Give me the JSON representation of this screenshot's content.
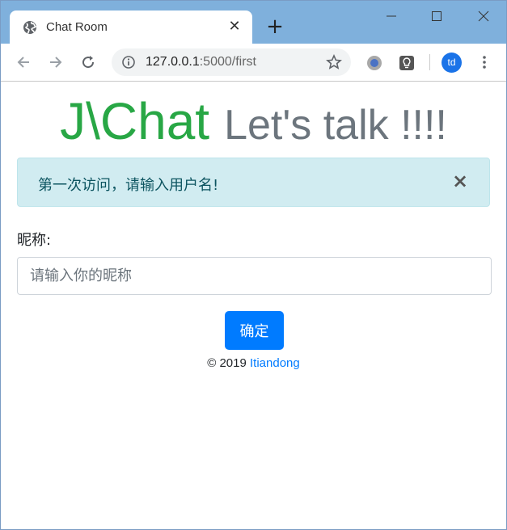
{
  "browser": {
    "tab_title": "Chat Room",
    "new_tab_label": "+",
    "url_host": "127.0.0.1",
    "url_path": ":5000/first",
    "avatar_initials": "td",
    "colors": {
      "titlebar": "#7fb0dc",
      "avatar": "#1a73e8"
    }
  },
  "page": {
    "brand_name": "J\\Chat",
    "tagline": "Let's talk !!!!",
    "alert": {
      "message": "第一次访问，请输入用户名!",
      "close_label": "×"
    },
    "form": {
      "nickname_label": "昵称:",
      "nickname_placeholder": "请输入你的昵称",
      "nickname_value": "",
      "submit_label": "确定"
    },
    "footer": {
      "copyright": "© 2019",
      "author": "Itiandong"
    },
    "colors": {
      "brand": "#28a745",
      "tagline": "#6c757d",
      "alert_bg": "#d1ecf1",
      "alert_text": "#0c5460",
      "button": "#007bff",
      "link": "#007bff"
    }
  }
}
